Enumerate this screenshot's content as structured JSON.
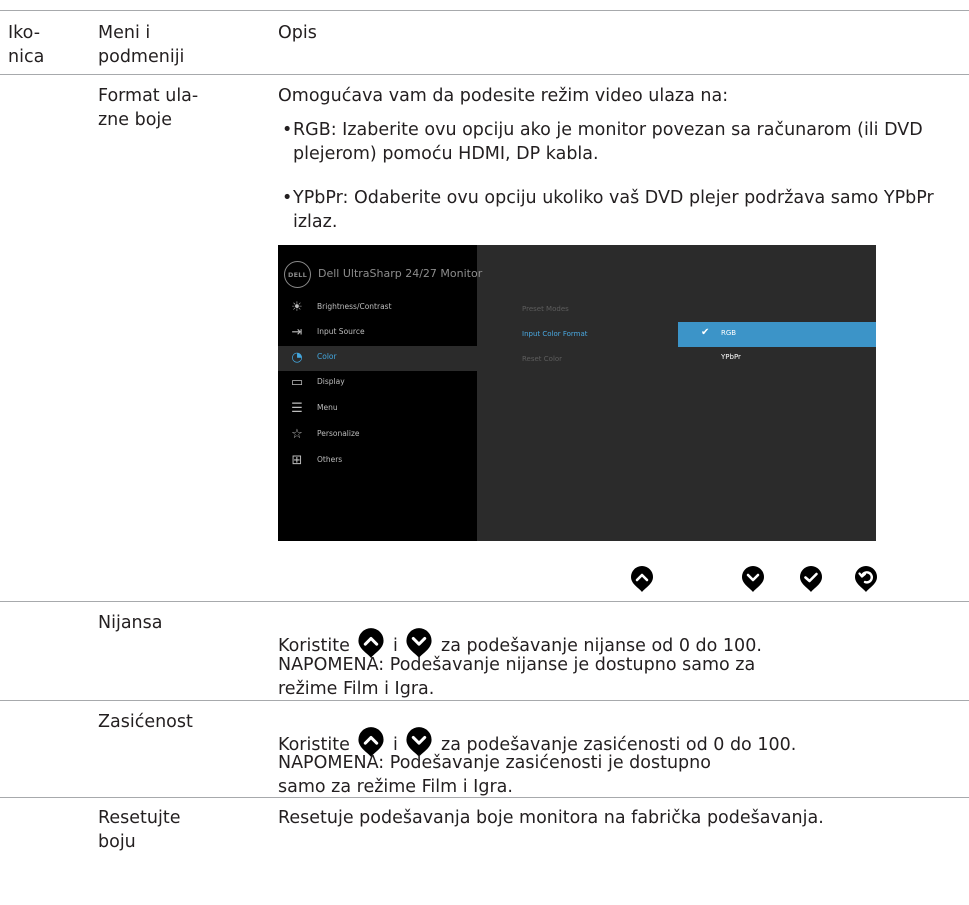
{
  "header": {
    "col1": "Iko-\nnica",
    "col2": "Meni i\npodmeniji",
    "col3": "Opis"
  },
  "format": {
    "name": "Format ula-\nzne boje",
    "intro": "Omogućava vam da podesite režim video ulaza na:",
    "bullet_char": "•",
    "bullet1": "RGB: Izaberite ovu opciju ako je monitor povezan sa računarom (ili DVD plejerom) pomoću HDMI, DP kabla.",
    "bullet2": "YPbPr: Odaberite ovu opciju ukoliko vaš DVD plejer podržava samo YPbPr izlaz."
  },
  "osd": {
    "logo": "DELL",
    "title": "Dell UltraSharp 24/27 Monitor",
    "menu": [
      {
        "label": "Brightness/Contrast",
        "icon": "brightness-icon",
        "glyph": "☀"
      },
      {
        "label": "Input Source",
        "icon": "input-source-icon",
        "glyph": "⇥"
      },
      {
        "label": "Color",
        "icon": "color-palette-icon",
        "glyph": "◔"
      },
      {
        "label": "Display",
        "icon": "display-icon",
        "glyph": "▭"
      },
      {
        "label": "Menu",
        "icon": "menu-icon",
        "glyph": "☰"
      },
      {
        "label": "Personalize",
        "icon": "star-icon",
        "glyph": "☆"
      },
      {
        "label": "Others",
        "icon": "others-icon",
        "glyph": "⊞"
      }
    ],
    "submenu": [
      "Preset Modes",
      "Input Color Format",
      "Reset Color"
    ],
    "options": [
      "RGB",
      "YPbPr"
    ],
    "check": "✔",
    "colors": {
      "accent": "#3c94c8",
      "active_text": "#43a6dd"
    }
  },
  "nav_buttons": [
    "up-button-icon",
    "down-button-icon",
    "check-button-icon",
    "back-button-icon"
  ],
  "nijansa": {
    "name": "Nijansa",
    "pre": "Koristite",
    "mid": "i",
    "post": "za podešavanje nijanse od 0 do 100.",
    "note": "NAPOMENA: Podešavanje nijanse je dostupno samo za režime Film i Igra."
  },
  "zasicenost": {
    "name": "Zasićenost",
    "pre": "Koristite",
    "mid": "i",
    "post": "za podešavanje zasićenosti od 0 do 100.",
    "note": "NAPOMENA: Podešavanje zasićenosti je dostupno samo za režime Film i Igra."
  },
  "reset": {
    "name": "Resetujte\nboju",
    "desc": "Resetuje podešavanja boje monitora na fabrička podešavanja."
  }
}
